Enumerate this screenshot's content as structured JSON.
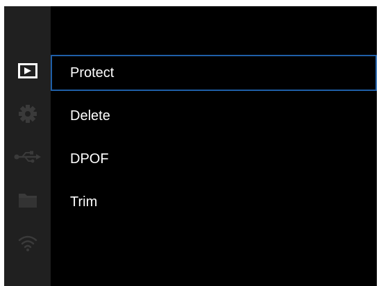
{
  "sidebar": {
    "icons": [
      {
        "name": "playback-icon",
        "active": true
      },
      {
        "name": "gear-icon",
        "active": false
      },
      {
        "name": "usb-icon",
        "active": false
      },
      {
        "name": "folder-icon",
        "active": false
      },
      {
        "name": "wifi-icon",
        "active": false
      }
    ]
  },
  "menu": {
    "items": [
      {
        "label": "Protect",
        "selected": true
      },
      {
        "label": "Delete",
        "selected": false
      },
      {
        "label": "DPOF",
        "selected": false
      },
      {
        "label": "Trim",
        "selected": false
      }
    ]
  },
  "colors": {
    "background": "#000000",
    "sidebar": "#202020",
    "selection_border": "#1f5fa8",
    "active_icon": "#ffffff",
    "inactive_icon": "#3a3a3a",
    "text": "#ffffff"
  }
}
